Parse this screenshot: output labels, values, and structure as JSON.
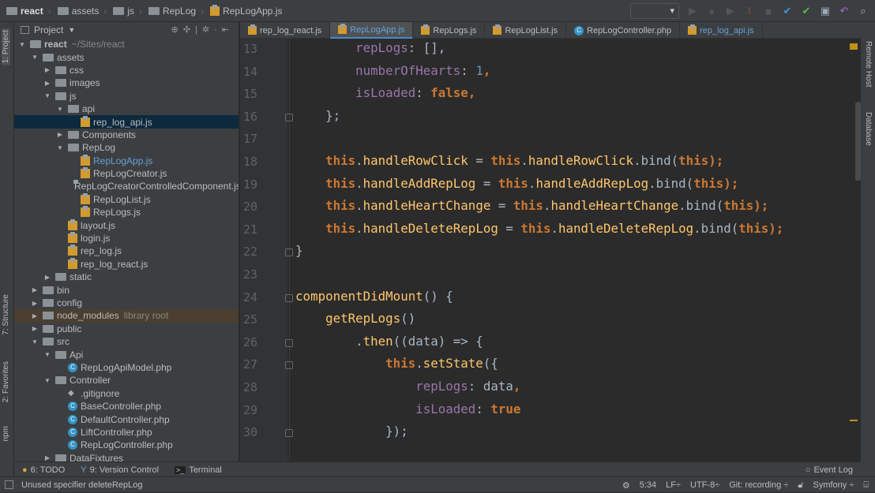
{
  "breadcrumb": [
    "react",
    "assets",
    "js",
    "RepLog",
    "RepLogApp.js"
  ],
  "toolwindows": {
    "left": [
      "1: Project",
      "7: Structure",
      "2: Favorites",
      "npm"
    ],
    "right": [
      "Remote Host",
      "Database"
    ]
  },
  "project": {
    "title": "Project",
    "tree": [
      {
        "d": 0,
        "a": "▼",
        "i": "folder",
        "t": "react",
        "extra": "~/Sites/react",
        "bold": true
      },
      {
        "d": 1,
        "a": "▼",
        "i": "folder",
        "t": "assets"
      },
      {
        "d": 2,
        "a": "▶",
        "i": "folder",
        "t": "css"
      },
      {
        "d": 2,
        "a": "▶",
        "i": "folder",
        "t": "images"
      },
      {
        "d": 2,
        "a": "▼",
        "i": "folder",
        "t": "js"
      },
      {
        "d": 3,
        "a": "▼",
        "i": "folder",
        "t": "api"
      },
      {
        "d": 4,
        "a": "",
        "i": "js",
        "t": "rep_log_api.js",
        "sel": true
      },
      {
        "d": 3,
        "a": "▶",
        "i": "folder",
        "t": "Components"
      },
      {
        "d": 3,
        "a": "▼",
        "i": "folder",
        "t": "RepLog"
      },
      {
        "d": 4,
        "a": "",
        "i": "js",
        "t": "RepLogApp.js",
        "blue": true
      },
      {
        "d": 4,
        "a": "",
        "i": "js",
        "t": "RepLogCreator.js"
      },
      {
        "d": 4,
        "a": "",
        "i": "js",
        "t": "RepLogCreatorControlledComponent.js"
      },
      {
        "d": 4,
        "a": "",
        "i": "js",
        "t": "RepLogList.js"
      },
      {
        "d": 4,
        "a": "",
        "i": "js",
        "t": "RepLogs.js"
      },
      {
        "d": 3,
        "a": "",
        "i": "js",
        "t": "layout.js"
      },
      {
        "d": 3,
        "a": "",
        "i": "js",
        "t": "login.js"
      },
      {
        "d": 3,
        "a": "",
        "i": "js",
        "t": "rep_log.js"
      },
      {
        "d": 3,
        "a": "",
        "i": "js",
        "t": "rep_log_react.js"
      },
      {
        "d": 2,
        "a": "▶",
        "i": "folder",
        "t": "static"
      },
      {
        "d": 1,
        "a": "▶",
        "i": "folder",
        "t": "bin"
      },
      {
        "d": 1,
        "a": "▶",
        "i": "folder",
        "t": "config"
      },
      {
        "d": 1,
        "a": "▶",
        "i": "folder",
        "t": "node_modules",
        "extra": "library root",
        "hl": true
      },
      {
        "d": 1,
        "a": "▶",
        "i": "folder",
        "t": "public"
      },
      {
        "d": 1,
        "a": "▼",
        "i": "folder",
        "t": "src"
      },
      {
        "d": 2,
        "a": "▼",
        "i": "folder",
        "t": "Api"
      },
      {
        "d": 3,
        "a": "",
        "i": "class",
        "t": "RepLogApiModel.php"
      },
      {
        "d": 2,
        "a": "▼",
        "i": "folder",
        "t": "Controller"
      },
      {
        "d": 3,
        "a": "",
        "i": "git",
        "t": ".gitignore"
      },
      {
        "d": 3,
        "a": "",
        "i": "class",
        "t": "BaseController.php"
      },
      {
        "d": 3,
        "a": "",
        "i": "class",
        "t": "DefaultController.php"
      },
      {
        "d": 3,
        "a": "",
        "i": "class",
        "t": "LiftController.php"
      },
      {
        "d": 3,
        "a": "",
        "i": "class",
        "t": "RepLogController.php"
      },
      {
        "d": 2,
        "a": "▶",
        "i": "folder",
        "t": "DataFixtures"
      }
    ]
  },
  "tabs": [
    {
      "t": "rep_log_react.js",
      "i": "js"
    },
    {
      "t": "RepLogApp.js",
      "i": "js",
      "active": true
    },
    {
      "t": "RepLogs.js",
      "i": "js"
    },
    {
      "t": "RepLogList.js",
      "i": "js"
    },
    {
      "t": "RepLogController.php",
      "i": "class"
    },
    {
      "t": "rep_log_api.js",
      "i": "js",
      "blue": true
    }
  ],
  "code": [
    {
      "n": "13",
      "fold": false,
      "tok": [
        [
          "            ",
          "t"
        ],
        [
          "repLogs",
          "p"
        ],
        [
          ": [],",
          "t"
        ]
      ]
    },
    {
      "n": "14",
      "tok": [
        [
          "            ",
          "t"
        ],
        [
          "numberOfHearts",
          "p"
        ],
        [
          ": ",
          "t"
        ],
        [
          "1",
          "n"
        ],
        [
          ",",
          "k"
        ]
      ]
    },
    {
      "n": "15",
      "tok": [
        [
          "            ",
          "t"
        ],
        [
          "isLoaded",
          "p"
        ],
        [
          ": ",
          "t"
        ],
        [
          "false",
          "k"
        ],
        [
          ",",
          "k"
        ]
      ]
    },
    {
      "n": "16",
      "fold": true,
      "tok": [
        [
          "        };",
          "t"
        ]
      ]
    },
    {
      "n": "17",
      "tok": []
    },
    {
      "n": "18",
      "tok": [
        [
          "        ",
          "t"
        ],
        [
          "this",
          "k"
        ],
        [
          ".",
          "t"
        ],
        [
          "handleRowClick",
          "m"
        ],
        [
          " = ",
          "t"
        ],
        [
          "this",
          "k"
        ],
        [
          ".",
          "t"
        ],
        [
          "handleRowClick",
          "m"
        ],
        [
          ".bind(",
          "t"
        ],
        [
          "this",
          "k"
        ],
        [
          ");",
          "k"
        ]
      ]
    },
    {
      "n": "19",
      "tok": [
        [
          "        ",
          "t"
        ],
        [
          "this",
          "k"
        ],
        [
          ".",
          "t"
        ],
        [
          "handleAddRepLog",
          "m"
        ],
        [
          " = ",
          "t"
        ],
        [
          "this",
          "k"
        ],
        [
          ".",
          "t"
        ],
        [
          "handleAddRepLog",
          "m"
        ],
        [
          ".bind(",
          "t"
        ],
        [
          "this",
          "k"
        ],
        [
          ");",
          "k"
        ]
      ]
    },
    {
      "n": "20",
      "tok": [
        [
          "        ",
          "t"
        ],
        [
          "this",
          "k"
        ],
        [
          ".",
          "t"
        ],
        [
          "handleHeartChange",
          "m"
        ],
        [
          " = ",
          "t"
        ],
        [
          "this",
          "k"
        ],
        [
          ".",
          "t"
        ],
        [
          "handleHeartChange",
          "m"
        ],
        [
          ".bind(",
          "t"
        ],
        [
          "this",
          "k"
        ],
        [
          ");",
          "k"
        ]
      ]
    },
    {
      "n": "21",
      "tok": [
        [
          "        ",
          "t"
        ],
        [
          "this",
          "k"
        ],
        [
          ".",
          "t"
        ],
        [
          "handleDeleteRepLog",
          "m"
        ],
        [
          " = ",
          "t"
        ],
        [
          "this",
          "k"
        ],
        [
          ".",
          "t"
        ],
        [
          "handleDeleteRepLog",
          "m"
        ],
        [
          ".bind(",
          "t"
        ],
        [
          "this",
          "k"
        ],
        [
          ");",
          "k"
        ]
      ]
    },
    {
      "n": "22",
      "fold": true,
      "tok": [
        [
          "    }",
          "t"
        ]
      ]
    },
    {
      "n": "23",
      "tok": []
    },
    {
      "n": "24",
      "fold": true,
      "tok": [
        [
          "    ",
          "t"
        ],
        [
          "componentDidMount",
          "m"
        ],
        [
          "() {",
          "t"
        ]
      ]
    },
    {
      "n": "25",
      "tok": [
        [
          "        ",
          "t"
        ],
        [
          "getRepLogs",
          "m"
        ],
        [
          "()",
          "t"
        ]
      ]
    },
    {
      "n": "26",
      "fold": true,
      "tok": [
        [
          "            .",
          "t"
        ],
        [
          "then",
          "m"
        ],
        [
          "((data) => {",
          "t"
        ]
      ]
    },
    {
      "n": "27",
      "fold": true,
      "tok": [
        [
          "                ",
          "t"
        ],
        [
          "this",
          "k"
        ],
        [
          ".",
          "t"
        ],
        [
          "setState",
          "m"
        ],
        [
          "({",
          "t"
        ]
      ]
    },
    {
      "n": "28",
      "tok": [
        [
          "                    ",
          "t"
        ],
        [
          "repLogs",
          "p"
        ],
        [
          ": data",
          "t"
        ],
        [
          ",",
          "k"
        ]
      ]
    },
    {
      "n": "29",
      "tok": [
        [
          "                    ",
          "t"
        ],
        [
          "isLoaded",
          "p"
        ],
        [
          ": ",
          "t"
        ],
        [
          "true",
          "k"
        ]
      ]
    },
    {
      "n": "30",
      "fold": true,
      "tok": [
        [
          "                });",
          "t"
        ]
      ]
    }
  ],
  "bottom_tabs": [
    "6: TODO",
    "9: Version Control",
    "Terminal"
  ],
  "event_log": "Event Log",
  "status": {
    "message": "Unused specifier deleteRepLog",
    "position": "5:34",
    "line_sep": "LF÷",
    "encoding": "UTF-8÷",
    "git": "Git: recording ÷",
    "framework": "Symfony ÷"
  }
}
